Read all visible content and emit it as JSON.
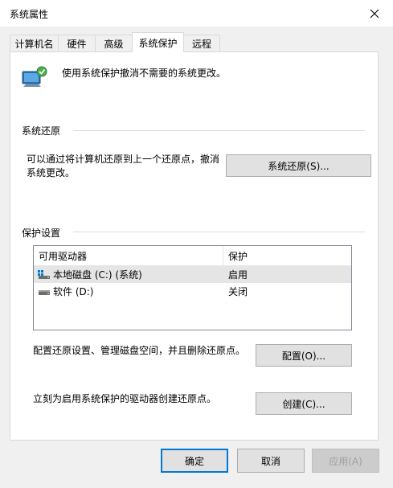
{
  "window": {
    "title": "系统属性"
  },
  "tabs": [
    {
      "label": "计算机名"
    },
    {
      "label": "硬件"
    },
    {
      "label": "高级"
    },
    {
      "label": "系统保护",
      "active": true
    },
    {
      "label": "远程"
    }
  ],
  "intro": {
    "text": "使用系统保护撤消不需要的系统更改。"
  },
  "restore_section": {
    "title": "系统还原",
    "description": "可以通过将计算机还原到上一个还原点，撤消系统更改。",
    "button": "系统还原(S)..."
  },
  "protection_section": {
    "title": "保护设置",
    "columns": [
      "可用驱动器",
      "保护"
    ],
    "drives": [
      {
        "name": "本地磁盘 (C:) (系统)",
        "protection": "启用",
        "icon": "system-drive-icon"
      },
      {
        "name": "软件 (D:)",
        "protection": "关闭",
        "icon": "drive-icon"
      }
    ],
    "configure_text": "配置还原设置、管理磁盘空间，并且删除还原点。",
    "configure_button": "配置(O)...",
    "create_text": "立刻为启用系统保护的驱动器创建还原点。",
    "create_button": "创建(C)..."
  },
  "footer": {
    "ok": "确定",
    "cancel": "取消",
    "apply": "应用(A)"
  },
  "colors": {
    "accent": "#0078d7",
    "selected_row": "#e5e5e5"
  }
}
